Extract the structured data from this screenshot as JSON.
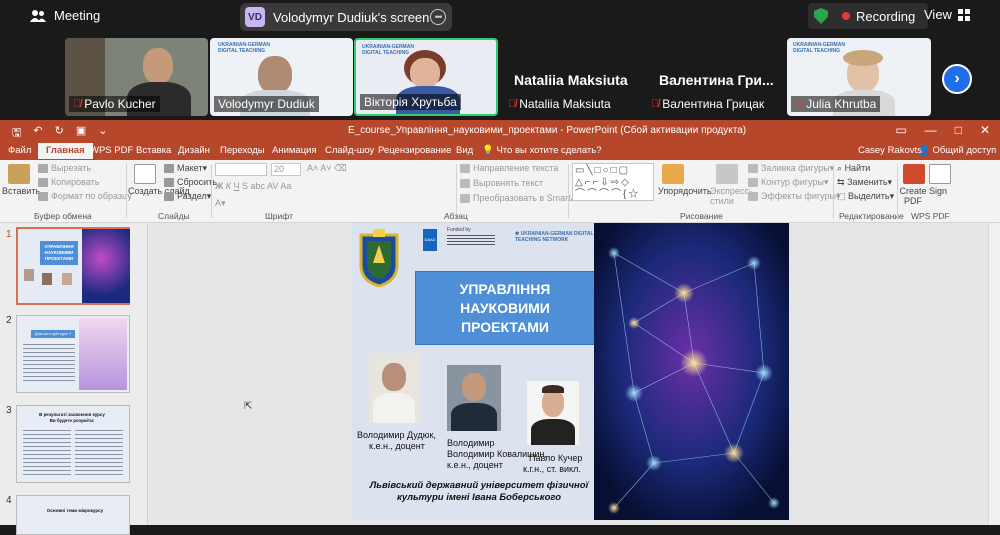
{
  "zoom_bar": {
    "meeting_label": "Meeting",
    "share": {
      "initials": "VD",
      "text": "Volodymyr Dudiuk's screen"
    },
    "recording_label": "Recording",
    "view_label": "View"
  },
  "participants": [
    {
      "name": "Pavlo Kucher"
    },
    {
      "name": "Volodymyr Dudiuk"
    },
    {
      "name": "Вікторія Хрутьба"
    },
    {
      "name": "Nataliia Maksiuta"
    },
    {
      "name": "Валентина Грицак",
      "display": "Валентина  Гри..."
    },
    {
      "name": "Julia Khrutba"
    }
  ],
  "ppt": {
    "title": "E_course_Управління_науковими_проектами - PowerPoint (Сбой активации продукта)",
    "user": "Casey Rakovtsi",
    "share_label": "Общий доступ",
    "tell_me": "Что вы хотите сделать?",
    "tabs": [
      "Файл",
      "Главная",
      "WPS PDF",
      "Вставка",
      "Дизайн",
      "Переходы",
      "Анимация",
      "Слайд-шоу",
      "Рецензирование",
      "Вид"
    ],
    "ribbon": {
      "paste": "Вставить",
      "cut": "Вырезать",
      "copy": "Копировать",
      "format_painter": "Формат по образцу",
      "clipboard": "Буфер обмена",
      "new_slide": "Создать слайд",
      "layout": "Макет",
      "reset": "Сбросить",
      "section": "Раздел",
      "slides": "Слайды",
      "font_size": "20",
      "font": "Шрифт",
      "text_direction": "Направление текста",
      "align_text": "Выровнять текст",
      "smartart": "Преобразовать в SmartArt",
      "paragraph": "Абзац",
      "arrange": "Упорядочить",
      "quick_styles": "Экспресс-стили",
      "shape_fill": "Заливка фигуры",
      "shape_outline": "Контур фигуры",
      "shape_effects": "Эффекты фигуры",
      "drawing": "Рисование",
      "find": "Найти",
      "replace": "Заменить",
      "select": "Выделить",
      "editing": "Редактирование",
      "create_pdf": "Create PDF",
      "sign": "Sign",
      "wps_pdf": "WPS PDF"
    },
    "thumbnails": [
      {
        "number": "1",
        "title": "УПРАВЛІННЯ НАУКОВИМИ ПРОЕКТАМИ"
      },
      {
        "number": "2",
        "title": "Для кого цей курс ?"
      },
      {
        "number": "3",
        "title": "В результаті засвоєння курсу Ви будете розуміти:"
      },
      {
        "number": "4",
        "title": "Основні теми мікрокурсу"
      }
    ]
  },
  "slide": {
    "funded_by": "Funded by",
    "daad": "DAAD",
    "network_name": "UKRAINIAN-GERMAN DIGITAL TEACHING NETWORK",
    "title": "УПРАВЛІННЯ НАУКОВИМИ ПРОЕКТАМИ",
    "people": [
      {
        "name": "Володимир Дудюк,",
        "degree": "к.е.н., доцент"
      },
      {
        "name": "Володимир Ковалишин,",
        "degree": "к.е.н., доцент"
      },
      {
        "name": "Павло Кучер",
        "degree": "к.г.н., ст. викл."
      }
    ],
    "university": "Львівський державний університет фізичної культури імені Івана Боберського"
  },
  "colors": {
    "ppt_accent": "#b7472a",
    "title_box": "#4f8fd8",
    "recording": "#e53935",
    "security": "#2aa54a",
    "active_speaker": "#2ecc71"
  }
}
